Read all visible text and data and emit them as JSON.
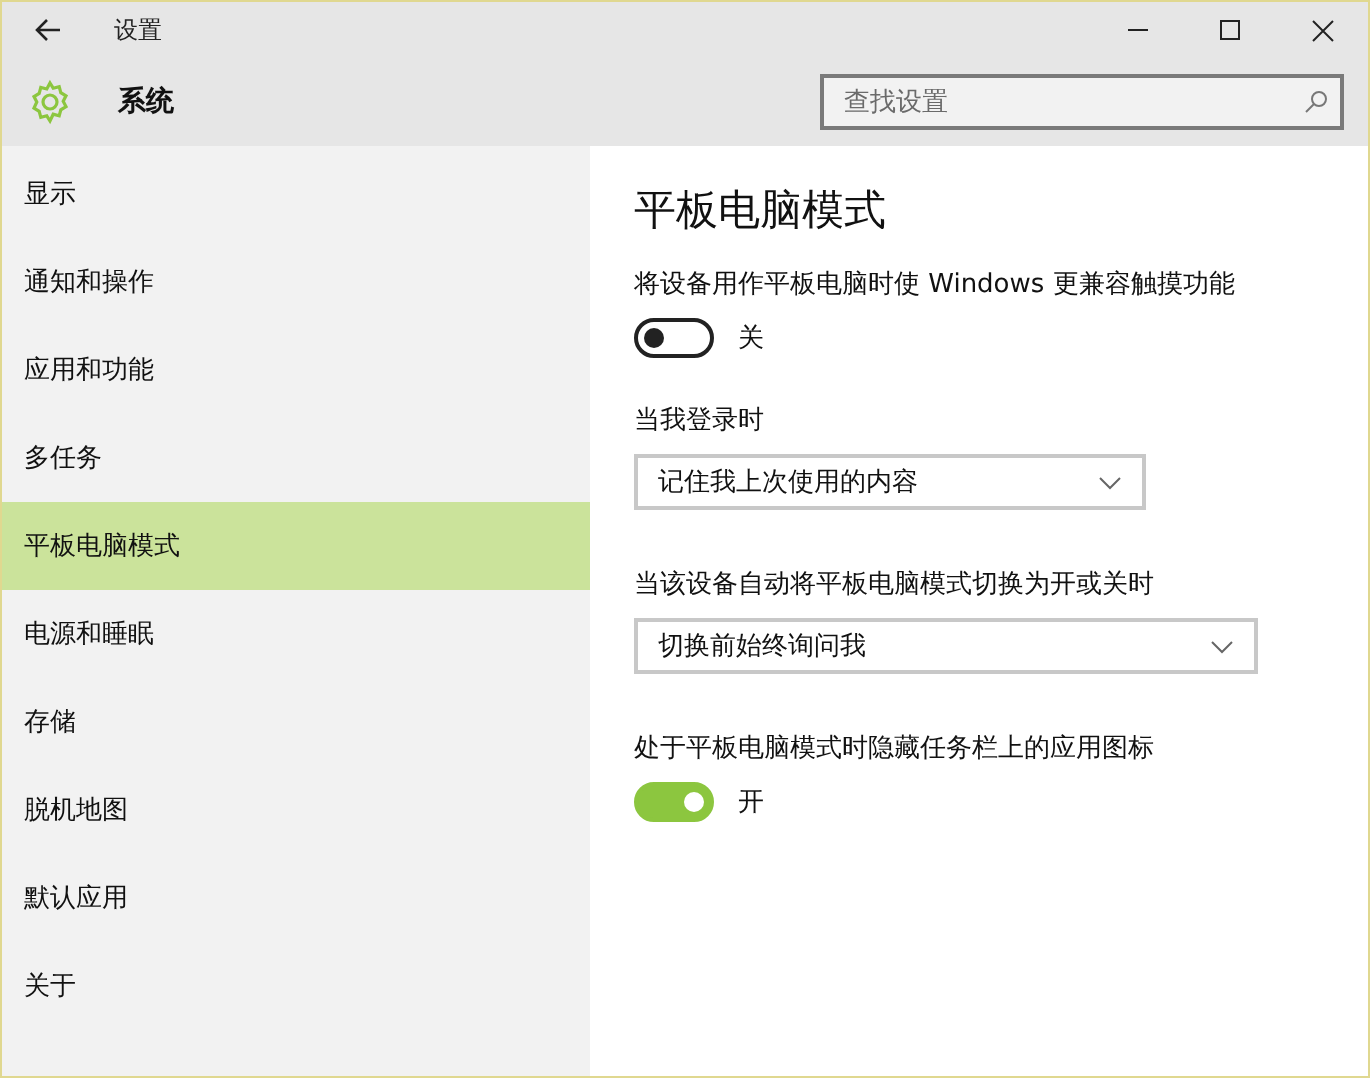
{
  "window": {
    "title": "设置"
  },
  "header": {
    "title": "系统",
    "search": {
      "placeholder": "查找设置"
    }
  },
  "sidebar": {
    "items": [
      {
        "label": "显示",
        "selected": false
      },
      {
        "label": "通知和操作",
        "selected": false
      },
      {
        "label": "应用和功能",
        "selected": false
      },
      {
        "label": "多任务",
        "selected": false
      },
      {
        "label": "平板电脑模式",
        "selected": true
      },
      {
        "label": "电源和睡眠",
        "selected": false
      },
      {
        "label": "存储",
        "selected": false
      },
      {
        "label": "脱机地图",
        "selected": false
      },
      {
        "label": "默认应用",
        "selected": false
      },
      {
        "label": "关于",
        "selected": false
      }
    ]
  },
  "content": {
    "title": "平板电脑模式",
    "settings": [
      {
        "kind": "toggle",
        "label": "将设备用作平板电脑时使 Windows 更兼容触摸功能",
        "on": false,
        "state_label": "关"
      },
      {
        "kind": "dropdown",
        "label": "当我登录时",
        "value": "记住我上次使用的内容"
      },
      {
        "kind": "dropdown",
        "label": "当该设备自动将平板电脑模式切换为开或关时",
        "value": "切换前始终询问我"
      },
      {
        "kind": "toggle",
        "label": "处于平板电脑模式时隐藏任务栏上的应用图标",
        "on": true,
        "state_label": "开"
      }
    ]
  }
}
